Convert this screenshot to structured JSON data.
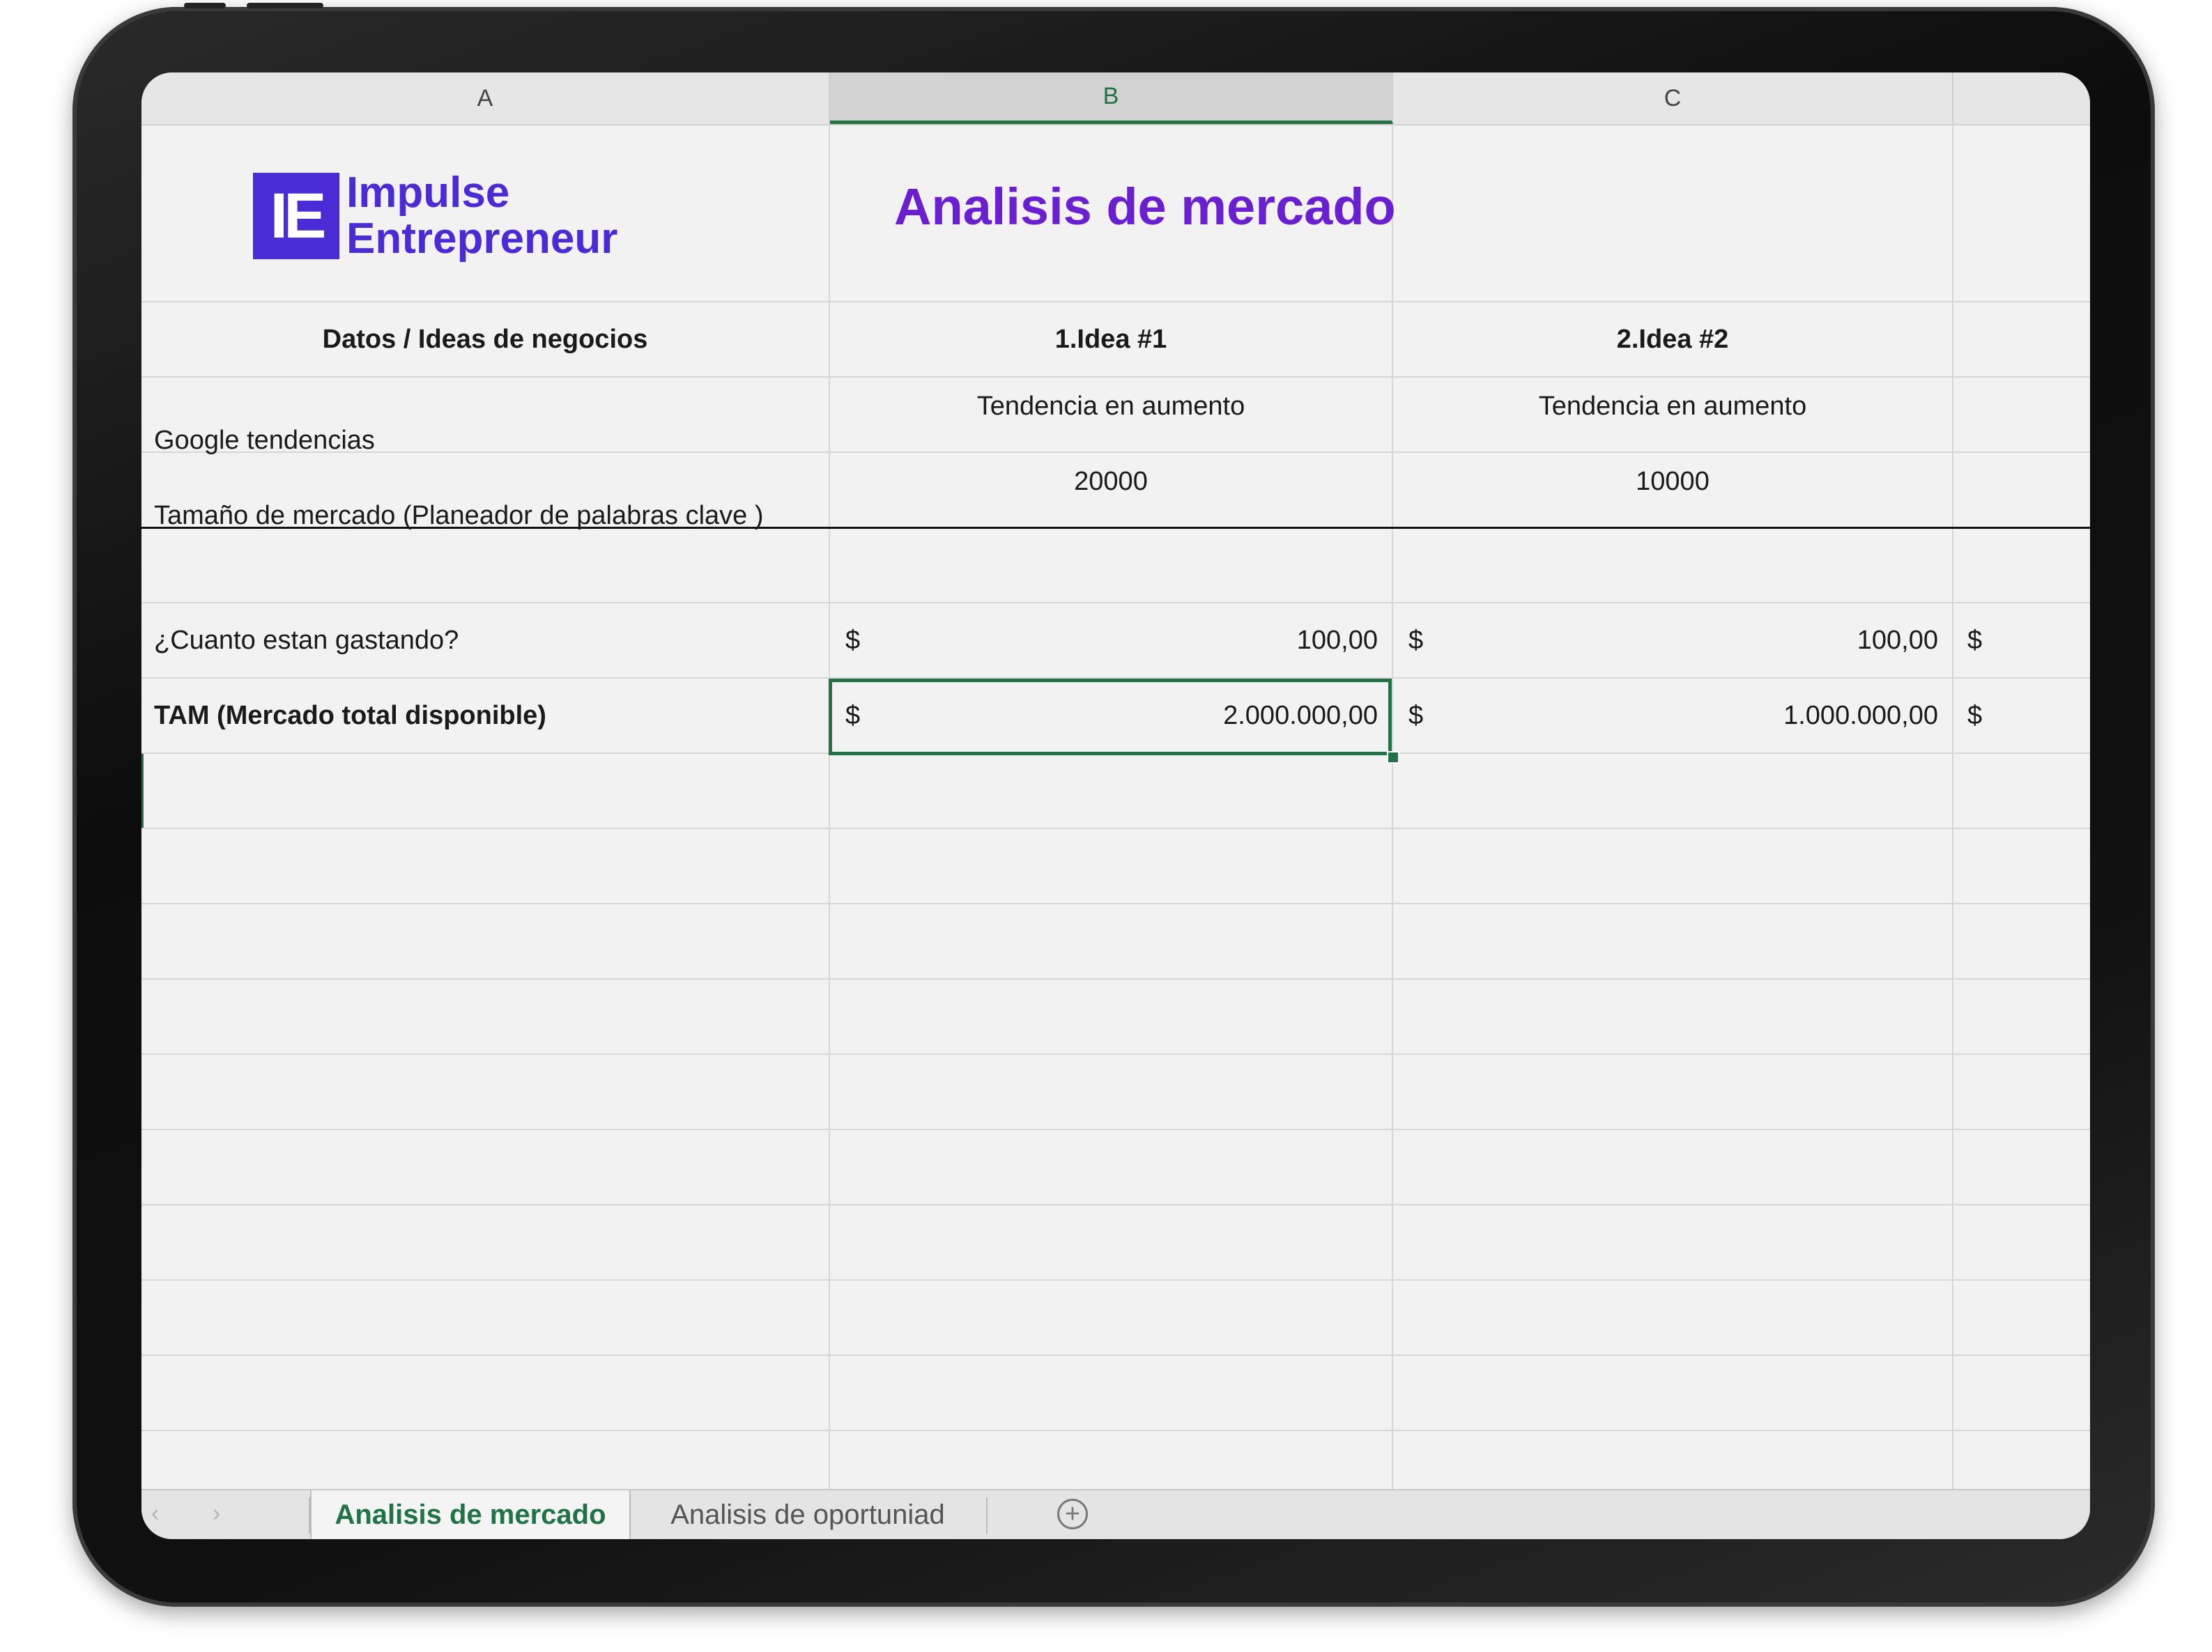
{
  "columns": [
    "A",
    "B",
    "C"
  ],
  "selected_column": "B",
  "logo": {
    "mark": "IE",
    "line1": "Impulse",
    "line2": "Entrepreneur"
  },
  "title": "Analisis de mercado",
  "header_row": {
    "a": "Datos / Ideas de negocios",
    "b": "1.Idea #1",
    "c": "2.Idea #2"
  },
  "rows": [
    {
      "label": "Google tendencias",
      "b": "Tendencia en aumento",
      "c": "Tendencia en aumento"
    },
    {
      "label": "Tamaño de mercado (Planeador de palabras clave )",
      "b": "20000",
      "c": "10000"
    },
    {
      "label": "¿Cuanto estan gastando?",
      "b_currency": "$",
      "b": "100,00",
      "c_currency": "$",
      "c": "100,00",
      "d_currency": "$"
    },
    {
      "label": "TAM (Mercado total disponible)",
      "b_currency": "$",
      "b": "2.000.000,00",
      "c_currency": "$",
      "c": "1.000.000,00",
      "d_currency": "$"
    }
  ],
  "tabs": [
    {
      "label": "Analisis de mercado",
      "active": true
    },
    {
      "label": "Analisis de oportuniad",
      "active": false
    }
  ],
  "tab_nav": {
    "prev": "‹",
    "next": "›",
    "add": "+"
  },
  "colors": {
    "accent_green": "#217346",
    "logo_blue": "#4b2bd6",
    "title_purple": "#6a1fd0"
  }
}
